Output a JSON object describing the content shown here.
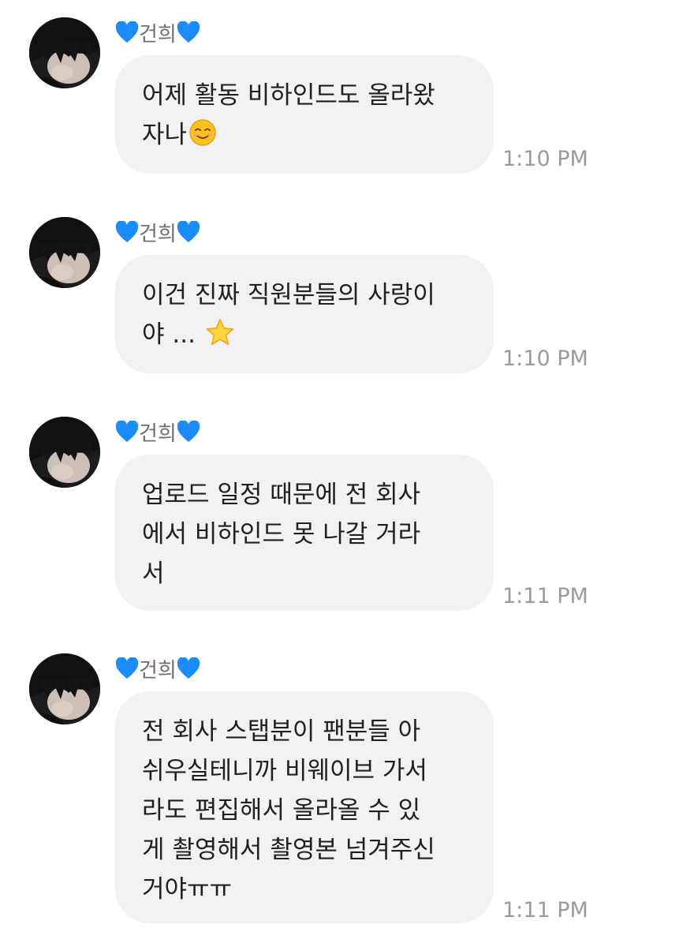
{
  "messages": [
    {
      "sender": "건희",
      "lines": [
        "어제 활동 비하인드도 올라왔",
        "자나"
      ],
      "emoji": "smiling-face-icon",
      "time": "1:10 PM"
    },
    {
      "sender": "건희",
      "lines": [
        "이건 진짜 직원분들의 사랑이",
        "야 ... "
      ],
      "emoji": "star-icon",
      "time": "1:10 PM"
    },
    {
      "sender": "건희",
      "lines": [
        "업로드 일정 때문에 전 회사",
        "에서 비하인드 못 나갈 거라",
        "서"
      ],
      "emoji": "",
      "time": "1:11 PM"
    },
    {
      "sender": "건희",
      "lines": [
        "전 회사 스탭분이 팬분들 아",
        "쉬우실테니까 비웨이브 가서",
        "라도 편집해서 올라올 수 있",
        "게 촬영해서 촬영본 넘겨주신",
        "거야ㅠㅠ"
      ],
      "emoji": "",
      "time": "1:11 PM"
    }
  ],
  "colors": {
    "bubble": "#f2f2f4",
    "heart": "#1a8cff",
    "sender_text": "#6f6f73",
    "time_text": "#9a9a9e"
  },
  "icons": {
    "heart": "blue-heart-icon",
    "avatar": "profile-photo"
  }
}
